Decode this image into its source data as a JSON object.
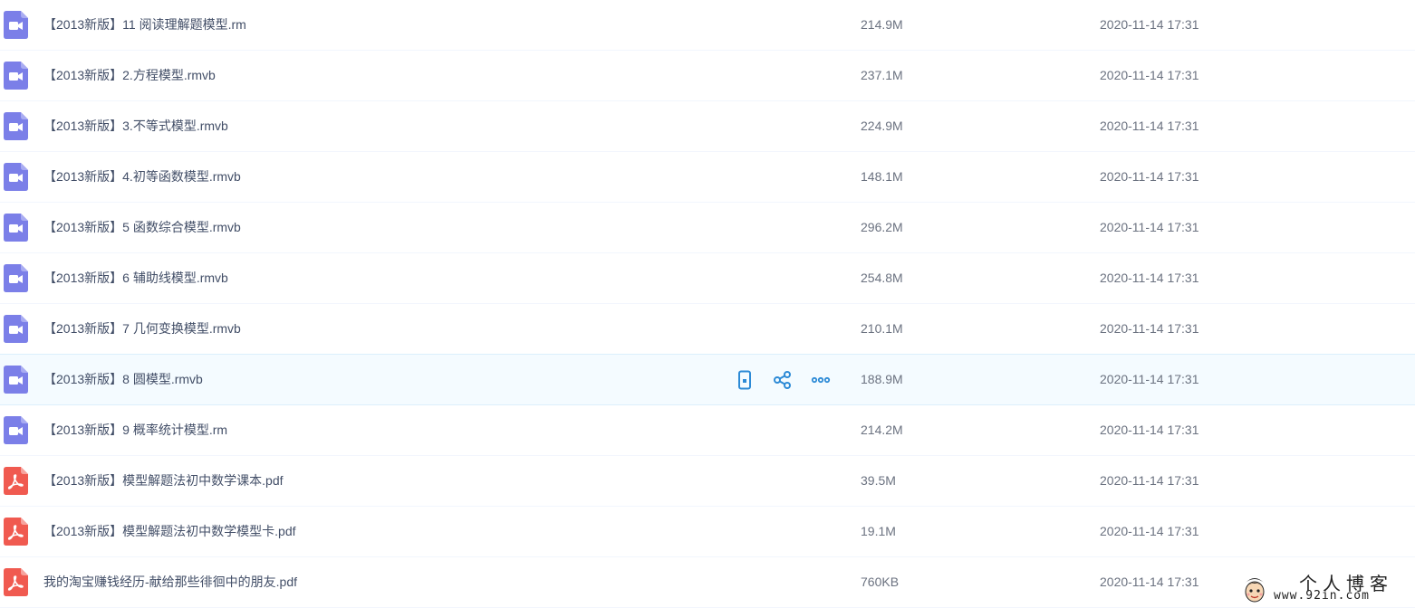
{
  "colors": {
    "video_icon": "#7b7fe8",
    "pdf_icon": "#f05a50",
    "action_icon": "#2c8ad6"
  },
  "files": [
    {
      "type": "video",
      "name": "【2013新版】11 阅读理解题模型.rm",
      "size": "214.9M",
      "date": "2020-11-14 17:31"
    },
    {
      "type": "video",
      "name": "【2013新版】2.方程模型.rmvb",
      "size": "237.1M",
      "date": "2020-11-14 17:31"
    },
    {
      "type": "video",
      "name": "【2013新版】3.不等式模型.rmvb",
      "size": "224.9M",
      "date": "2020-11-14 17:31"
    },
    {
      "type": "video",
      "name": "【2013新版】4.初等函数模型.rmvb",
      "size": "148.1M",
      "date": "2020-11-14 17:31"
    },
    {
      "type": "video",
      "name": "【2013新版】5 函数综合模型.rmvb",
      "size": "296.2M",
      "date": "2020-11-14 17:31"
    },
    {
      "type": "video",
      "name": "【2013新版】6 辅助线模型.rmvb",
      "size": "254.8M",
      "date": "2020-11-14 17:31"
    },
    {
      "type": "video",
      "name": "【2013新版】7 几何变换模型.rmvb",
      "size": "210.1M",
      "date": "2020-11-14 17:31"
    },
    {
      "type": "video",
      "name": "【2013新版】8 圆模型.rmvb",
      "size": "188.9M",
      "date": "2020-11-14 17:31",
      "hovered": true
    },
    {
      "type": "video",
      "name": "【2013新版】9 概率统计模型.rm",
      "size": "214.2M",
      "date": "2020-11-14 17:31"
    },
    {
      "type": "pdf",
      "name": "【2013新版】模型解题法初中数学课本.pdf",
      "size": "39.5M",
      "date": "2020-11-14 17:31"
    },
    {
      "type": "pdf",
      "name": "【2013新版】模型解题法初中数学模型卡.pdf",
      "size": "19.1M",
      "date": "2020-11-14 17:31"
    },
    {
      "type": "pdf",
      "name": "我的淘宝赚钱经历-献给那些徘徊中的朋友.pdf",
      "size": "760KB",
      "date": "2020-11-14 17:31"
    }
  ],
  "row_actions": [
    {
      "icon": "phone-icon"
    },
    {
      "icon": "share-icon"
    },
    {
      "icon": "more-icon"
    }
  ],
  "watermark": {
    "title": "个人博客",
    "url": "www.92in.com"
  }
}
